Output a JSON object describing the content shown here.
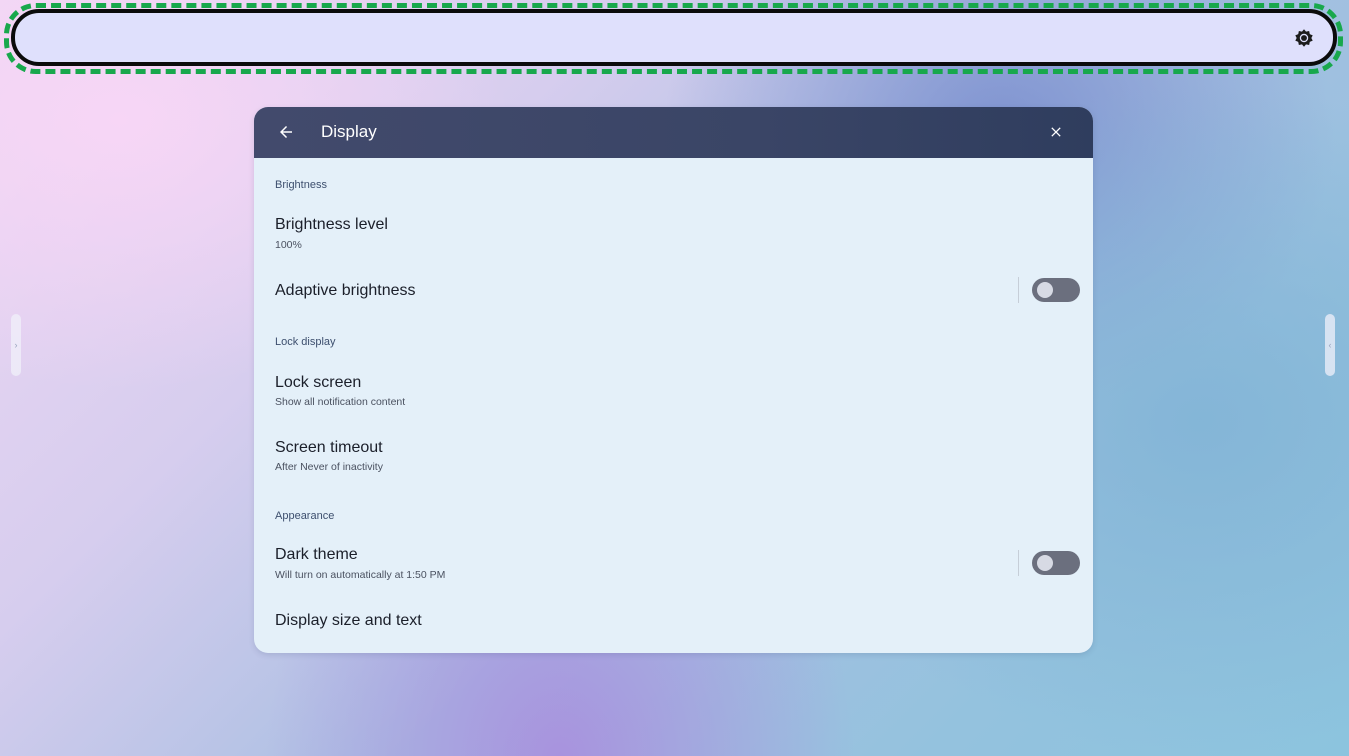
{
  "top_bar": {
    "brightness_icon": "brightness-icon"
  },
  "dialog": {
    "title": "Display",
    "back_icon": "arrow-left-icon",
    "close_icon": "close-icon",
    "sections": {
      "brightness": {
        "header": "Brightness",
        "brightness_level": {
          "title": "Brightness level",
          "subtitle": "100%"
        },
        "adaptive_brightness": {
          "title": "Adaptive brightness",
          "enabled": false
        }
      },
      "lock_display": {
        "header": "Lock display",
        "lock_screen": {
          "title": "Lock screen",
          "subtitle": "Show all notification content"
        },
        "screen_timeout": {
          "title": "Screen timeout",
          "subtitle": "After Never of inactivity"
        }
      },
      "appearance": {
        "header": "Appearance",
        "dark_theme": {
          "title": "Dark theme",
          "subtitle": "Will turn on automatically at 1:50 PM",
          "enabled": false
        },
        "display_size": {
          "title": "Display size and text"
        }
      }
    }
  },
  "colors": {
    "header_bg": "#3a4566",
    "dialog_bg": "#e4f0f9",
    "top_bar_bg": "#dfe0fc",
    "highlight": "#18a84c",
    "toggle_off": "#6b6f7e"
  }
}
